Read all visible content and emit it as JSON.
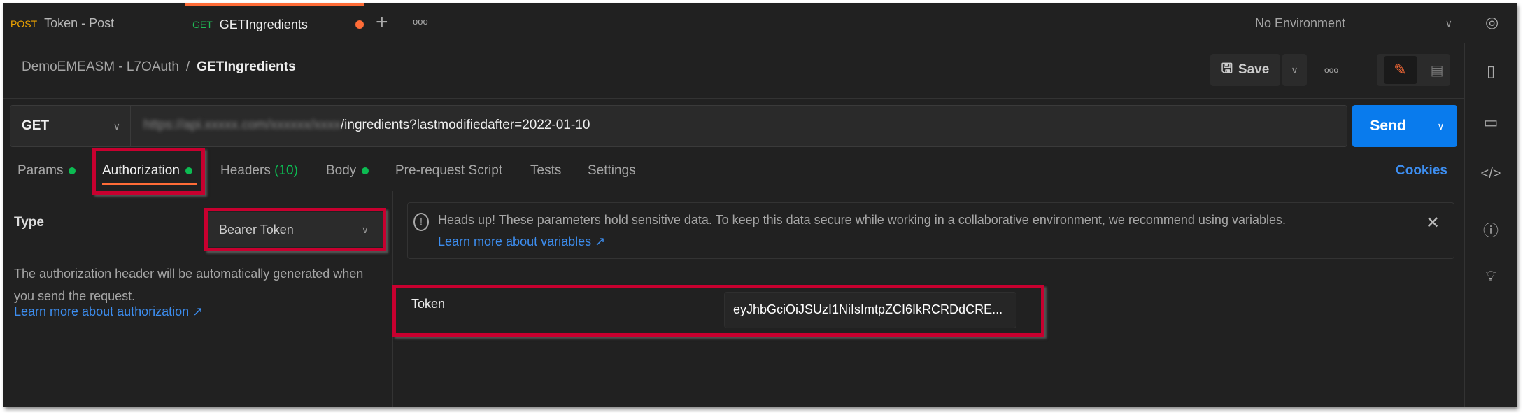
{
  "tabs": [
    {
      "method": "POST",
      "name": "Token - Post"
    },
    {
      "method": "GET",
      "name": "GETIngredients",
      "unsaved": true
    }
  ],
  "tabbar": {
    "new_tab": "+",
    "more": "ooo"
  },
  "environment": {
    "selected": "No Environment"
  },
  "breadcrumb": {
    "collection": "DemoEMEASM - L7OAuth",
    "separator": "/",
    "request": "GETIngredients"
  },
  "toolbar": {
    "save_label": "Save",
    "more": "ooo"
  },
  "request": {
    "method": "GET",
    "url_blurred": "https://api.xxxxx.com/xxxxxx/xxxx",
    "url_visible": "/ingredients?lastmodifiedafter=2022-01-10",
    "send_label": "Send"
  },
  "request_tabs": [
    {
      "label": "Params",
      "dot": true
    },
    {
      "label": "Authorization",
      "dot": true,
      "active": true
    },
    {
      "label": "Headers",
      "count": "(10)"
    },
    {
      "label": "Body",
      "dot": true
    },
    {
      "label": "Pre-request Script"
    },
    {
      "label": "Tests"
    },
    {
      "label": "Settings"
    }
  ],
  "cookies_label": "Cookies",
  "auth": {
    "type_label": "Type",
    "type_value": "Bearer Token",
    "description": "The authorization header will be automatically generated when you send the request.",
    "learn_more": "Learn more about authorization ↗"
  },
  "notice": {
    "text": "Heads up! These parameters hold sensitive data. To keep this data secure while working in a collaborative environment, we recommend using variables.",
    "link": "Learn more about variables ↗"
  },
  "token": {
    "label": "Token",
    "value": "eyJhbGciOiJSUzI1NiIsImtpZCI6IkRCRDdCRE..."
  },
  "colors": {
    "accent": "#ff6c37",
    "send": "#097bed",
    "link": "#3d8ef0",
    "highlight": "#c8002f"
  }
}
